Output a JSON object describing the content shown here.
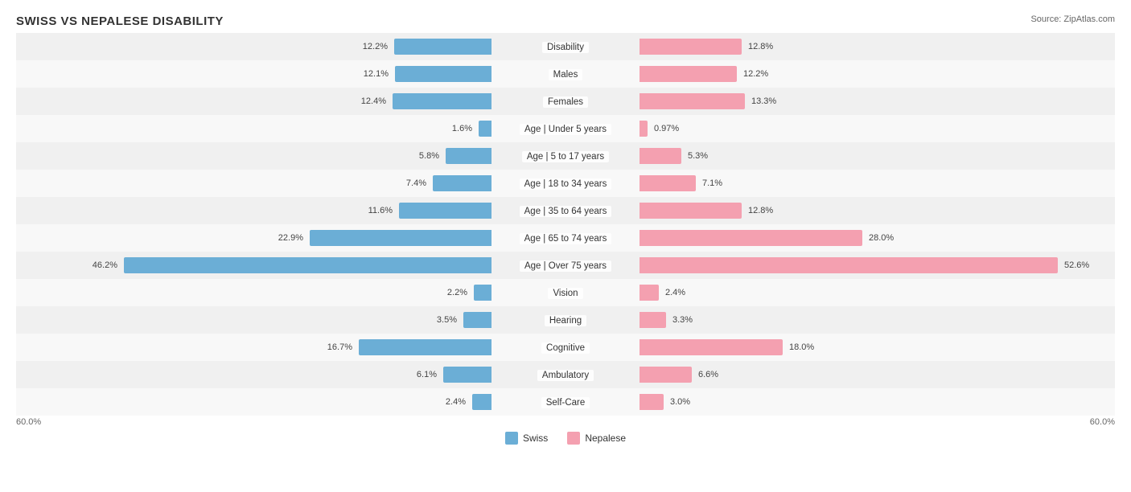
{
  "title": "SWISS VS NEPALESE DISABILITY",
  "source": "Source: ZipAtlas.com",
  "colors": {
    "blue": "#6baed6",
    "pink": "#f4a0b0",
    "blue_dark": "#4292c6",
    "pink_dark": "#e07090"
  },
  "scale_max": 60,
  "legend": {
    "swiss_label": "Swiss",
    "nepalese_label": "Nepalese"
  },
  "axis_left": "60.0%",
  "axis_right": "60.0%",
  "rows": [
    {
      "label": "Disability",
      "swiss": 12.2,
      "nepalese": 12.8,
      "swiss_label": "12.2%",
      "nepalese_label": "12.8%"
    },
    {
      "label": "Males",
      "swiss": 12.1,
      "nepalese": 12.2,
      "swiss_label": "12.1%",
      "nepalese_label": "12.2%"
    },
    {
      "label": "Females",
      "swiss": 12.4,
      "nepalese": 13.3,
      "swiss_label": "12.4%",
      "nepalese_label": "13.3%"
    },
    {
      "label": "Age | Under 5 years",
      "swiss": 1.6,
      "nepalese": 0.97,
      "swiss_label": "1.6%",
      "nepalese_label": "0.97%"
    },
    {
      "label": "Age | 5 to 17 years",
      "swiss": 5.8,
      "nepalese": 5.3,
      "swiss_label": "5.8%",
      "nepalese_label": "5.3%"
    },
    {
      "label": "Age | 18 to 34 years",
      "swiss": 7.4,
      "nepalese": 7.1,
      "swiss_label": "7.4%",
      "nepalese_label": "7.1%"
    },
    {
      "label": "Age | 35 to 64 years",
      "swiss": 11.6,
      "nepalese": 12.8,
      "swiss_label": "11.6%",
      "nepalese_label": "12.8%"
    },
    {
      "label": "Age | 65 to 74 years",
      "swiss": 22.9,
      "nepalese": 28.0,
      "swiss_label": "22.9%",
      "nepalese_label": "28.0%"
    },
    {
      "label": "Age | Over 75 years",
      "swiss": 46.2,
      "nepalese": 52.6,
      "swiss_label": "46.2%",
      "nepalese_label": "52.6%"
    },
    {
      "label": "Vision",
      "swiss": 2.2,
      "nepalese": 2.4,
      "swiss_label": "2.2%",
      "nepalese_label": "2.4%"
    },
    {
      "label": "Hearing",
      "swiss": 3.5,
      "nepalese": 3.3,
      "swiss_label": "3.5%",
      "nepalese_label": "3.3%"
    },
    {
      "label": "Cognitive",
      "swiss": 16.7,
      "nepalese": 18.0,
      "swiss_label": "16.7%",
      "nepalese_label": "18.0%"
    },
    {
      "label": "Ambulatory",
      "swiss": 6.1,
      "nepalese": 6.6,
      "swiss_label": "6.1%",
      "nepalese_label": "6.6%"
    },
    {
      "label": "Self-Care",
      "swiss": 2.4,
      "nepalese": 3.0,
      "swiss_label": "2.4%",
      "nepalese_label": "3.0%"
    }
  ]
}
